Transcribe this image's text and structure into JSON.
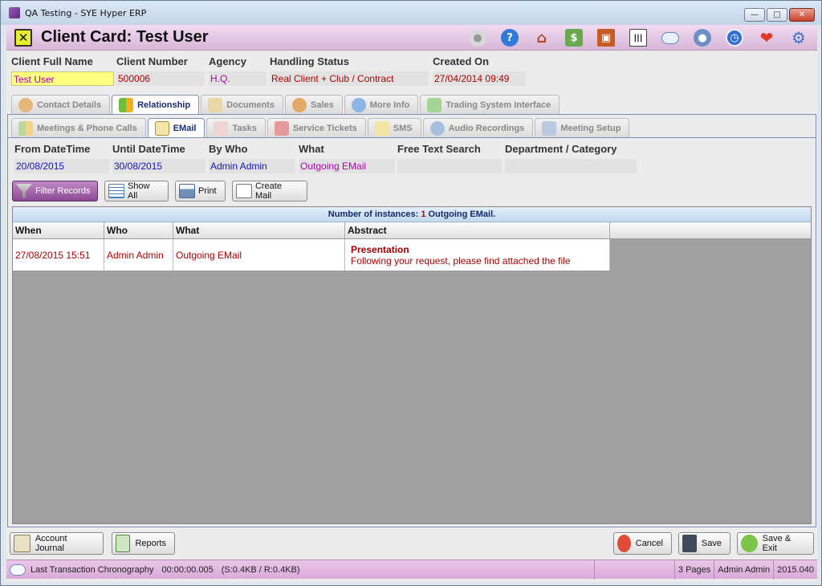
{
  "window": {
    "title": "QA Testing - SYE Hyper ERP"
  },
  "header": {
    "title": "Client Card: Test User"
  },
  "toolbar_icons": [
    "lightbulb-icon",
    "help-icon",
    "home-icon",
    "money-icon",
    "factory-icon",
    "barcode-icon",
    "cloud-icon",
    "user-icon",
    "clock-icon",
    "heart-icon",
    "gear-icon"
  ],
  "client": {
    "full_name_label": "Client Full Name",
    "full_name": "Test User",
    "number_label": "Client Number",
    "number": "500006",
    "agency_label": "Agency",
    "agency": "H.Q.",
    "status_label": "Handling Status",
    "status": "Real Client + Club / Contract",
    "created_label": "Created On",
    "created": "27/04/2014 09:49"
  },
  "main_tabs": [
    {
      "label": "Contact Details",
      "active": false
    },
    {
      "label": "Relationship",
      "active": true
    },
    {
      "label": "Documents",
      "active": false
    },
    {
      "label": "Sales",
      "active": false
    },
    {
      "label": "More Info",
      "active": false
    },
    {
      "label": "Trading System Interface",
      "active": false
    }
  ],
  "sub_tabs": [
    {
      "label": "Meetings & Phone Calls",
      "active": false
    },
    {
      "label": "EMail",
      "active": true
    },
    {
      "label": "Tasks",
      "active": false
    },
    {
      "label": "Service Tickets",
      "active": false
    },
    {
      "label": "SMS",
      "active": false
    },
    {
      "label": "Audio Recordings",
      "active": false
    },
    {
      "label": "Meeting Setup",
      "active": false
    }
  ],
  "filters": {
    "from_label": "From DateTime",
    "from": "20/08/2015",
    "until_label": "Until DateTime",
    "until": "30/08/2015",
    "who_label": "By Who",
    "who": "Admin Admin",
    "what_label": "What",
    "what": "Outgoing EMail",
    "search_label": "Free Text Search",
    "search": "",
    "dept_label": "Department / Category",
    "dept": ""
  },
  "actions": {
    "filter": "Filter Records",
    "show_all": "Show All",
    "print": "Print",
    "create_mail": "Create Mail"
  },
  "grid": {
    "caption_prefix": "Number of instances:",
    "count": "1",
    "caption_suffix": "Outgoing EMail.",
    "columns": [
      "When",
      "Who",
      "What",
      "Abstract"
    ],
    "rows": [
      {
        "when": "27/08/2015 15:51",
        "who": "Admin Admin",
        "what": "Outgoing EMail",
        "subject": "Presentation",
        "body": "Following your request, please find attached the file"
      }
    ]
  },
  "bottom": {
    "account_journal": "Account Journal",
    "reports": "Reports",
    "cancel": "Cancel",
    "save": "Save",
    "save_exit": "Save & Exit"
  },
  "status": {
    "transaction": "Last Transaction Chronography",
    "duration": "00:00:00.005",
    "sizes": "(S:0.4KB / R:0.4KB)",
    "pages": "3 Pages",
    "user": "Admin Admin",
    "version": "2015.040"
  },
  "colors": {
    "header_bg": "#d8b6d8",
    "accent_purple": "#8b4a93",
    "value_red": "#b00000",
    "value_blue": "#1414b8",
    "value_magenta": "#b000b0"
  }
}
